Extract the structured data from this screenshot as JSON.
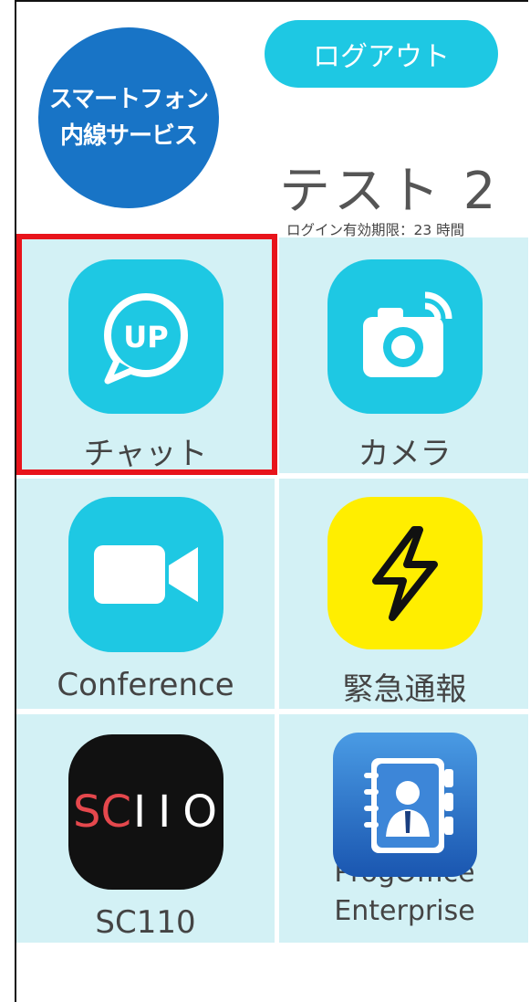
{
  "header": {
    "logo_line1": "スマートフォン",
    "logo_line2": "内線サービス",
    "logout_label": "ログアウト",
    "username": "テスト 2",
    "expiry": "ログイン有効期限：23 時間"
  },
  "apps": [
    {
      "label": "チャット",
      "icon": "chat-up-icon",
      "color": "#1ec8e3"
    },
    {
      "label": "カメラ",
      "icon": "camera-icon",
      "color": "#1ec8e3"
    },
    {
      "label": "Conference",
      "icon": "video-camera-icon",
      "color": "#1ec8e3"
    },
    {
      "label": "緊急通報",
      "icon": "lightning-icon",
      "color": "#ffee00"
    },
    {
      "label": "SC110",
      "icon": "sc110-logo-icon",
      "color": "#111111",
      "logo_text": "SCIIO"
    },
    {
      "label_line1": "ProgOffice",
      "label_line2": "Enterprise",
      "icon": "address-book-icon",
      "color": "#2a6fc9"
    }
  ],
  "highlight_color": "#e8141b"
}
